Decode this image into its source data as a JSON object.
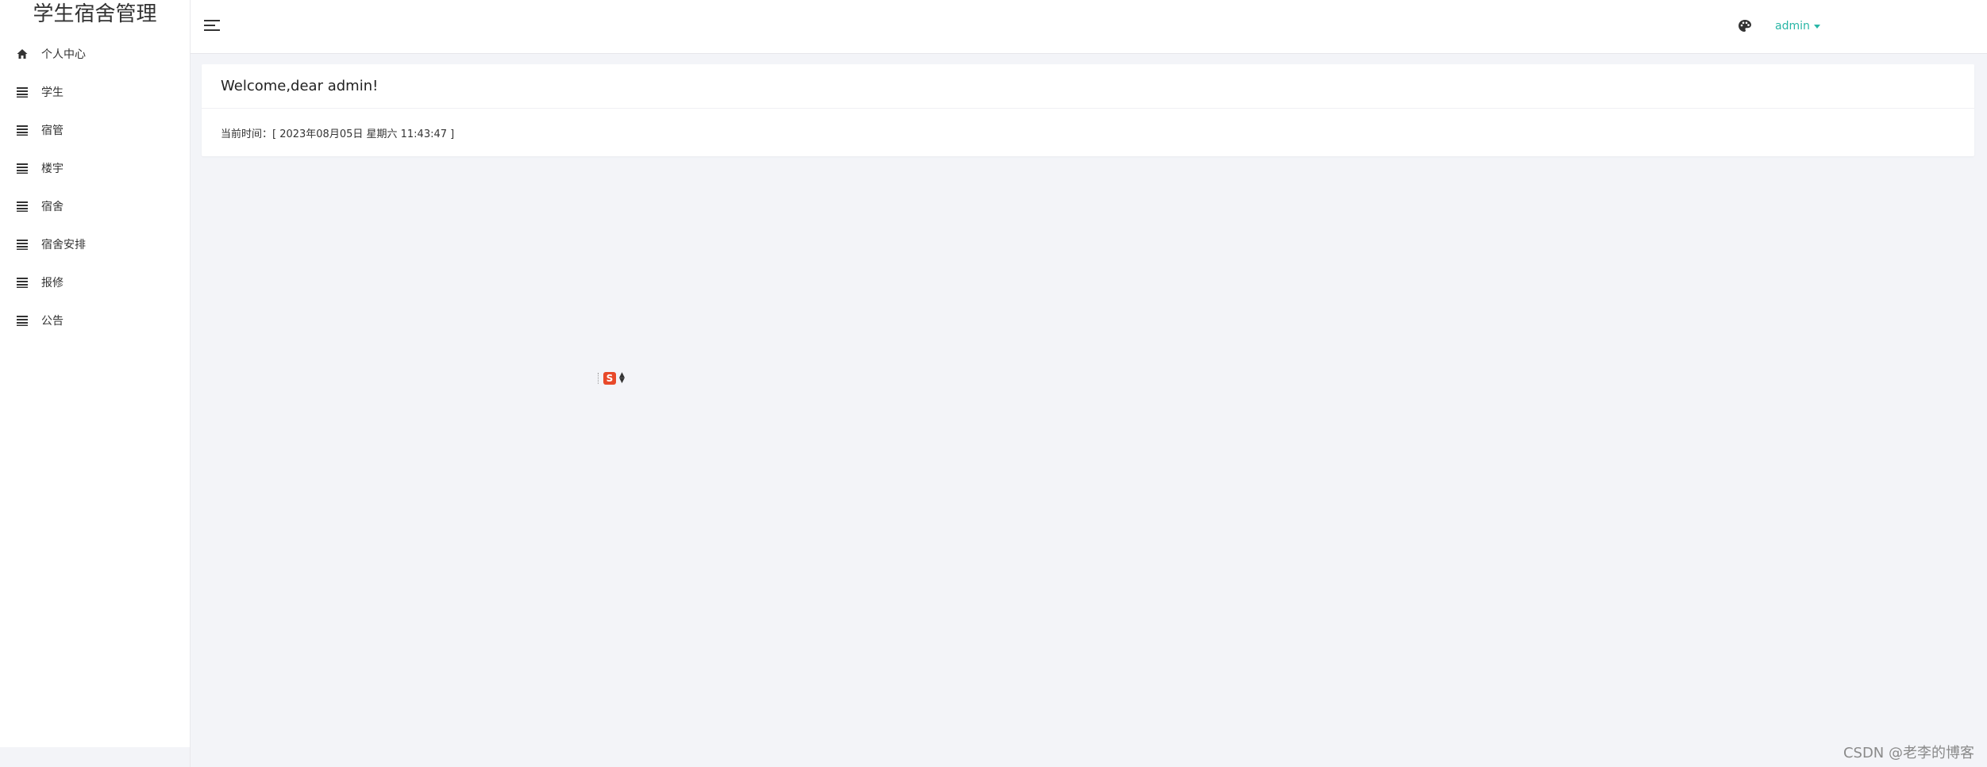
{
  "app": {
    "title": "学生宿舍管理"
  },
  "sidebar": {
    "items": [
      {
        "label": "个人中心",
        "icon": "home-icon"
      },
      {
        "label": "学生",
        "icon": "list-icon"
      },
      {
        "label": "宿管",
        "icon": "list-icon"
      },
      {
        "label": "楼宇",
        "icon": "list-icon"
      },
      {
        "label": "宿舍",
        "icon": "list-icon"
      },
      {
        "label": "宿舍安排",
        "icon": "list-icon"
      },
      {
        "label": "报修",
        "icon": "list-icon"
      },
      {
        "label": "公告",
        "icon": "list-icon"
      }
    ]
  },
  "header": {
    "user": "admin",
    "accent_color": "#29b6a6"
  },
  "welcome": {
    "title": "Welcome,dear admin!",
    "time_text": "当前时间：[ 2023年08月05日 星期六 11:43:47 ]"
  },
  "float_widget": {
    "logo": "S"
  },
  "watermark": "CSDN @老李的博客"
}
